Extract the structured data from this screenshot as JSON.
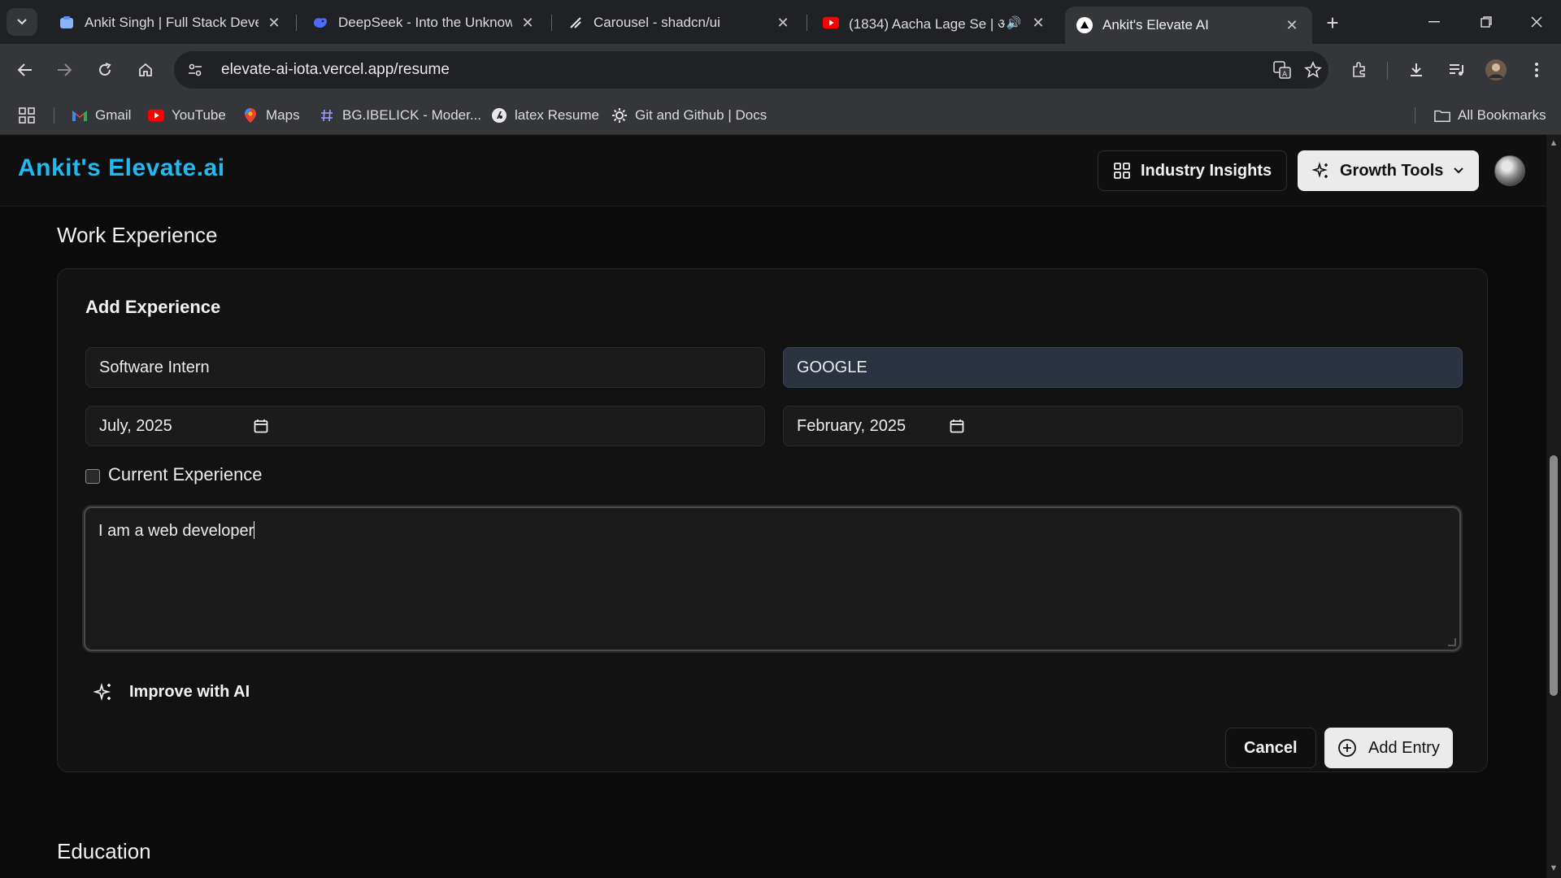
{
  "browser": {
    "tabs": [
      {
        "title": "Ankit Singh | Full Stack Develo",
        "icon": "portfolio-favicon"
      },
      {
        "title": "DeepSeek - Into the Unknown",
        "icon": "deepseek-favicon"
      },
      {
        "title": "Carousel - shadcn/ui",
        "icon": "shadcn-favicon"
      },
      {
        "title": "(1834) Aacha Lage Se | अ",
        "icon": "youtube-favicon",
        "audio": true
      },
      {
        "title": "Ankit's Elevate AI",
        "icon": "vercel-favicon",
        "active": true
      }
    ],
    "url": "elevate-ai-iota.vercel.app/resume",
    "bookmarks": [
      {
        "label": "Gmail",
        "icon": "gmail-icon"
      },
      {
        "label": "YouTube",
        "icon": "youtube-icon"
      },
      {
        "label": "Maps",
        "icon": "maps-icon"
      },
      {
        "label": "BG.IBELICK - Moder...",
        "icon": "hash-icon"
      },
      {
        "label": "latex Resume",
        "icon": "latex-icon"
      },
      {
        "label": "Git and Github | Docs",
        "icon": "gear-icon"
      }
    ],
    "all_bookmarks": "All Bookmarks"
  },
  "app": {
    "brand": "Ankit's Elevate.ai",
    "nav": {
      "industry_insights": "Industry Insights",
      "growth_tools": "Growth Tools"
    }
  },
  "work_experience": {
    "section_title": "Work Experience",
    "card_title": "Add Experience",
    "title_value": "Software Intern",
    "organization_value": "GOOGLE",
    "start_date": "July, 2025",
    "end_date": "February, 2025",
    "current_label": "Current Experience",
    "current_checked": false,
    "description": "I am a web developer",
    "improve_label": "Improve with AI",
    "cancel_label": "Cancel",
    "add_label": "Add Entry"
  },
  "education": {
    "section_title": "Education"
  },
  "colors": {
    "brand": "#22b8f0",
    "page_bg": "#0b0b0b",
    "card_bg": "#121212",
    "highlight_field": "#2b3240"
  }
}
